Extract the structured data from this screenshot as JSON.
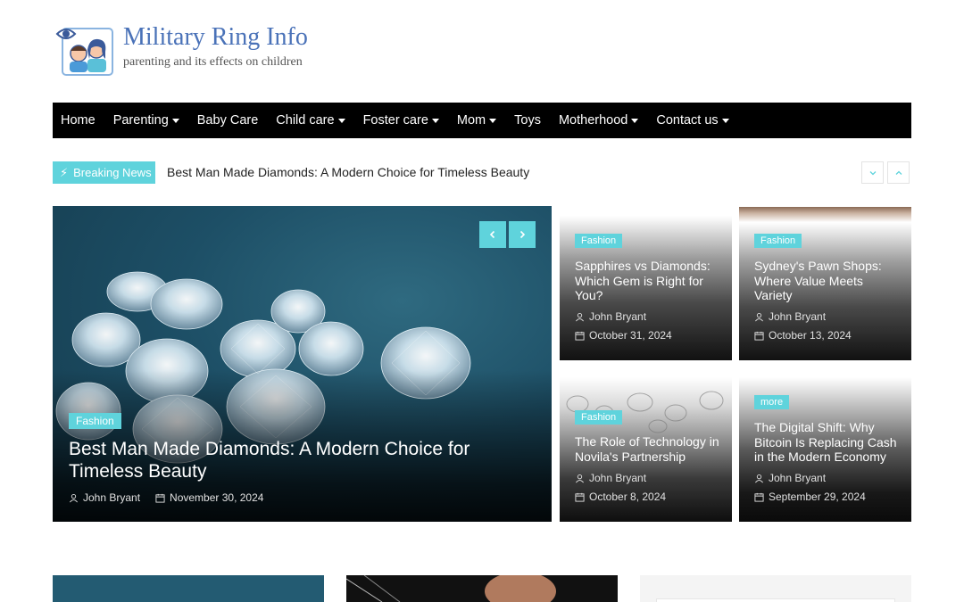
{
  "site": {
    "title": "Military Ring Info",
    "tagline": "parenting and its effects on children"
  },
  "nav": {
    "items": [
      {
        "label": "Home",
        "dropdown": false
      },
      {
        "label": "Parenting",
        "dropdown": true
      },
      {
        "label": "Baby Care",
        "dropdown": false
      },
      {
        "label": "Child care",
        "dropdown": true
      },
      {
        "label": "Foster care",
        "dropdown": true
      },
      {
        "label": "Mom",
        "dropdown": true
      },
      {
        "label": "Toys",
        "dropdown": false
      },
      {
        "label": "Motherhood",
        "dropdown": true
      },
      {
        "label": "Contact us",
        "dropdown": true
      }
    ]
  },
  "breaking": {
    "label": "Breaking News",
    "headline": "Best Man Made Diamonds: A Modern Choice for Timeless Beauty"
  },
  "hero": {
    "category": "Fashion",
    "title": "Best Man Made Diamonds: A Modern Choice for Timeless Beauty",
    "author": "John Bryant",
    "date": "November 30, 2024"
  },
  "cards": [
    {
      "category": "Fashion",
      "title": "Sapphires vs Diamonds: Which Gem is Right for You?",
      "author": "John Bryant",
      "date": "October 31, 2024"
    },
    {
      "category": "Fashion",
      "title": "Sydney's Pawn Shops: Where Value Meets Variety",
      "author": "John Bryant",
      "date": "October 13, 2024"
    },
    {
      "category": "Fashion",
      "title": "The Role of Technology in Novila's Partnership",
      "author": "John Bryant",
      "date": "October 8, 2024"
    },
    {
      "category": "more",
      "title": "The Digital Shift: Why Bitcoin Is Replacing Cash in the Modern Economy",
      "author": "John Bryant",
      "date": "September 29, 2024"
    }
  ],
  "colors": {
    "accent": "#5fd3dc",
    "nav_bg": "#000000",
    "logo_blue": "#4a72b8"
  },
  "icons": {
    "breaking": "bolt-icon",
    "author": "user-icon",
    "date": "calendar-icon",
    "prev": "chevron-left-icon",
    "next": "chevron-right-icon",
    "ticker_down": "chevron-down-icon",
    "ticker_up": "chevron-up-icon"
  }
}
